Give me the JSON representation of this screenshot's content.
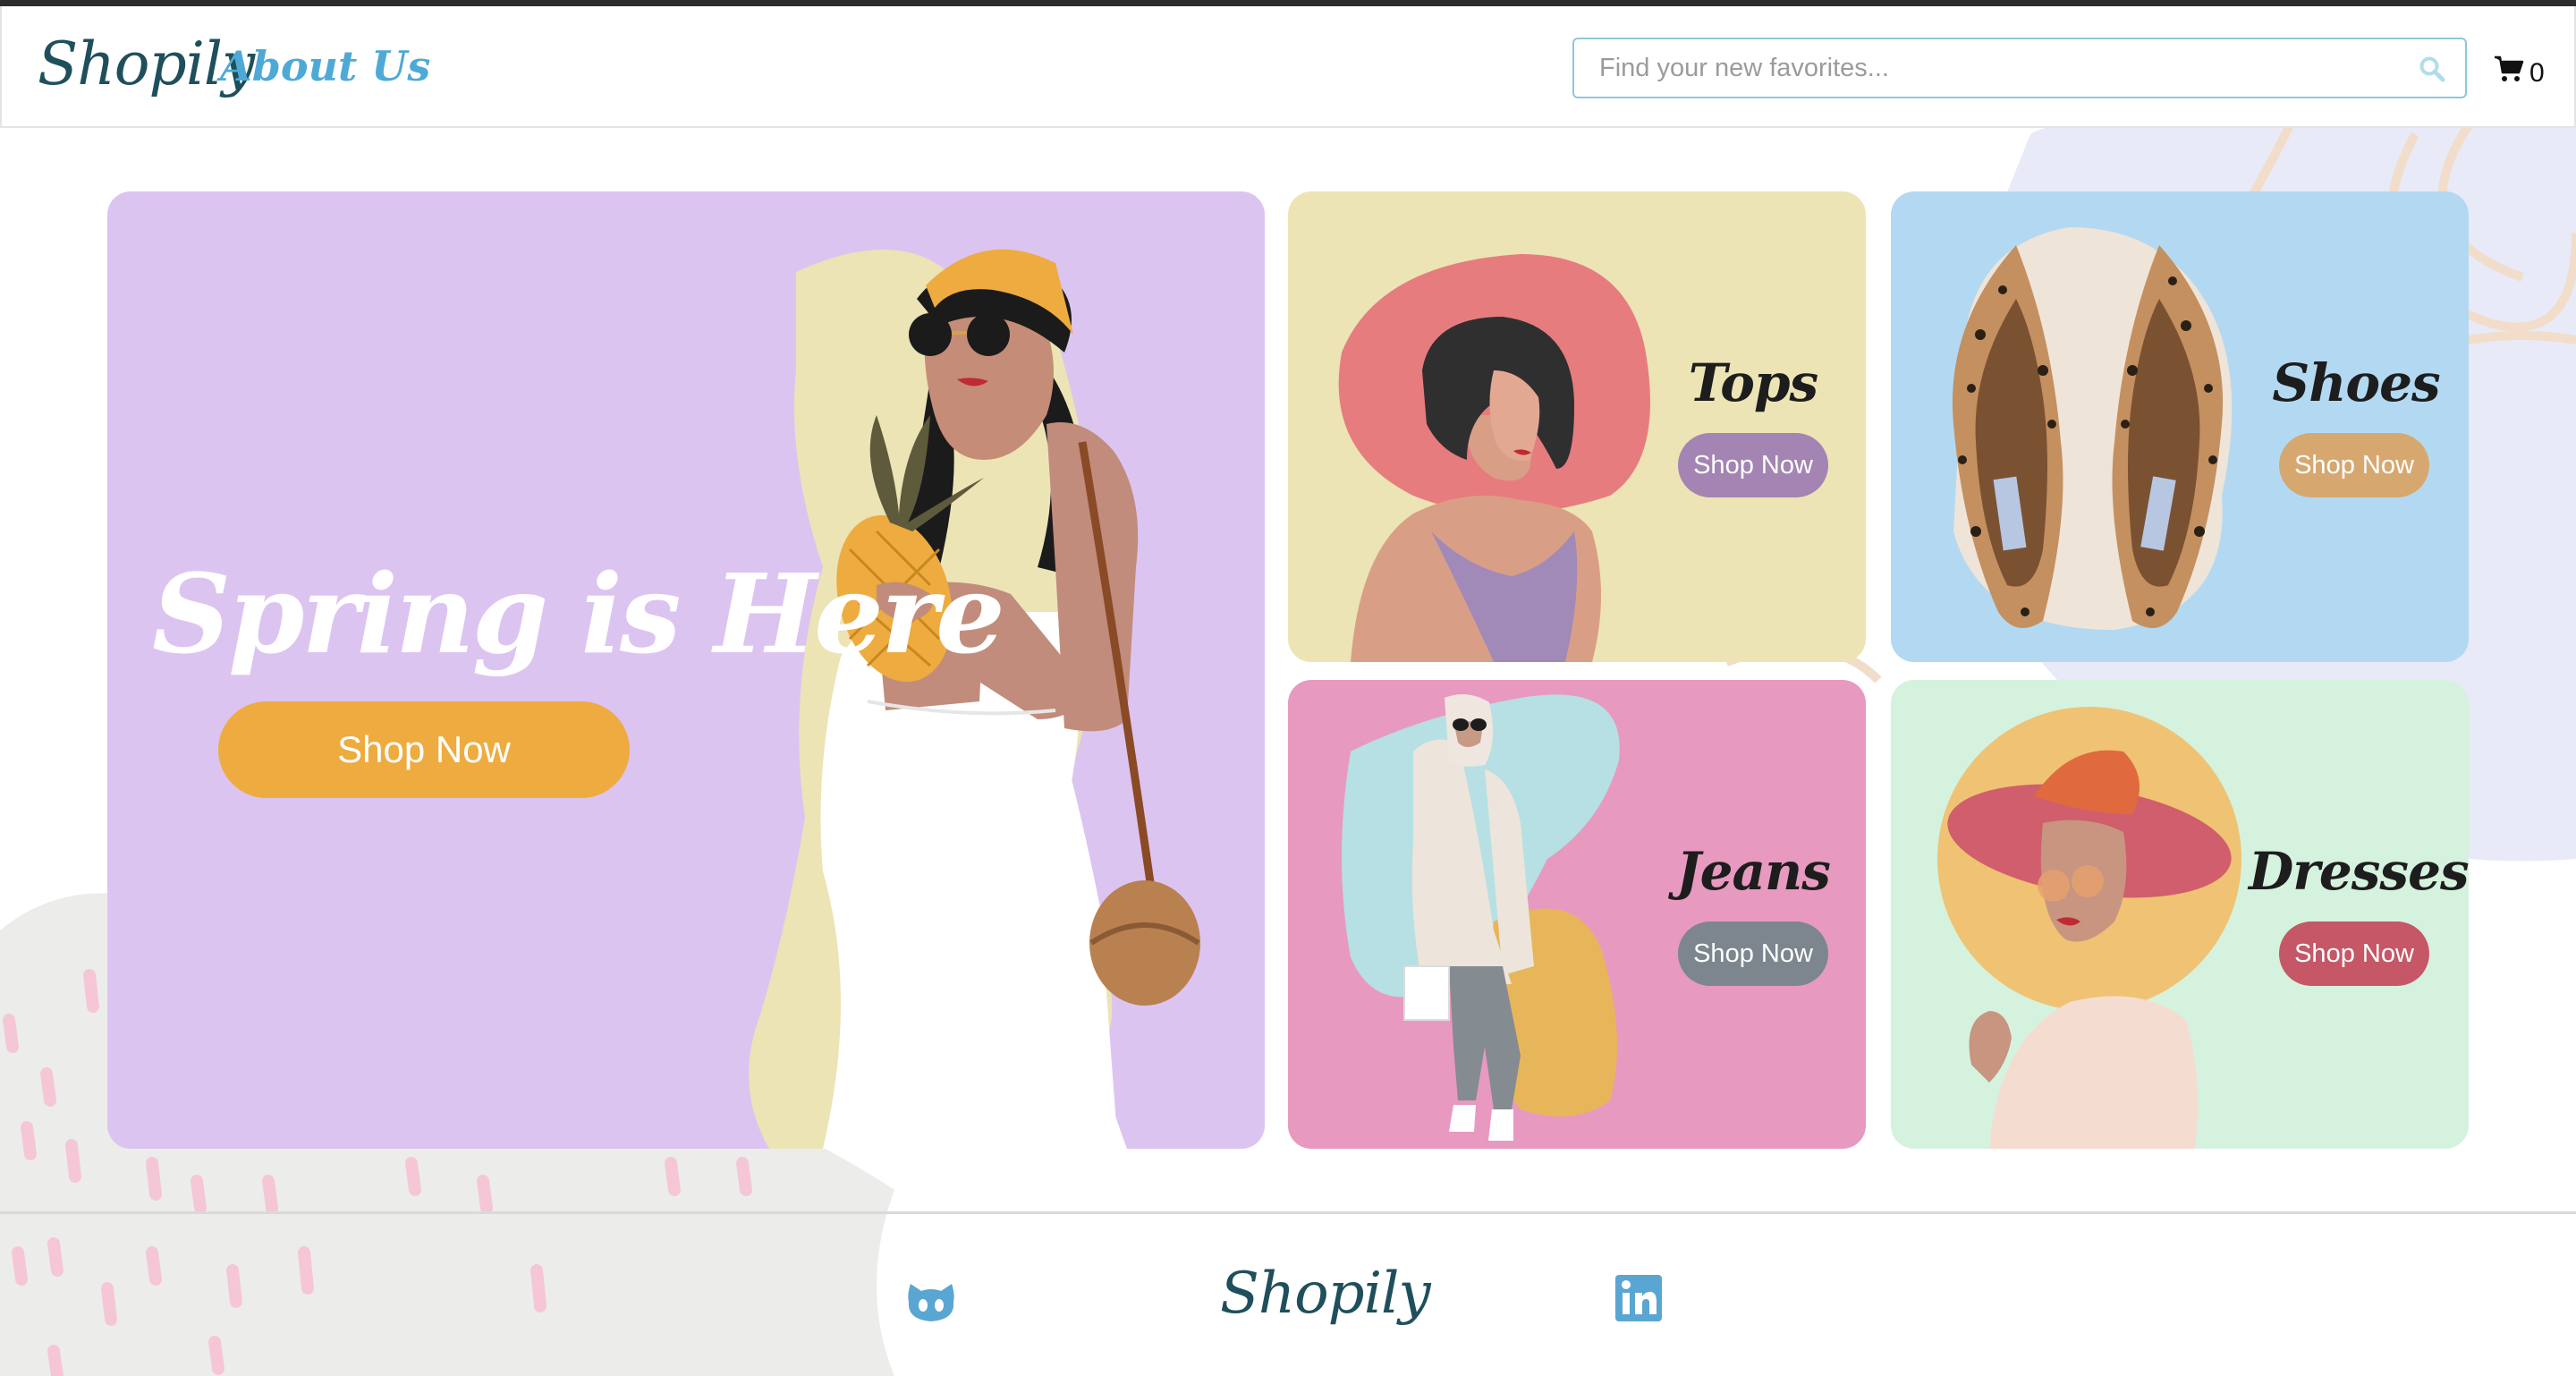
{
  "header": {
    "logo": "Shopily",
    "about_link": "About Us",
    "search_placeholder": "Find your new favorites...",
    "cart_count": "0",
    "icons": [
      "search-icon",
      "cart-icon"
    ]
  },
  "hero": {
    "title": "Spring is Here",
    "button_label": "Shop Now",
    "button_color": "#eeab3f",
    "background": "#dcc4f1"
  },
  "categories": [
    {
      "title": "Tops",
      "button_label": "Shop Now",
      "button_color": "#a384b3",
      "background": "#ece4b4"
    },
    {
      "title": "Shoes",
      "button_label": "Shop Now",
      "button_color": "#d6a870",
      "background": "#b3d9f2"
    },
    {
      "title": "Jeans",
      "button_label": "Shop Now",
      "button_color": "#7d868e",
      "background": "#e899bf"
    },
    {
      "title": "Dresses",
      "button_label": "Shop Now",
      "button_color": "#c55766",
      "background": "#d5f2df"
    }
  ],
  "footer": {
    "logo": "Shopily",
    "icons": [
      "github-icon",
      "linkedin-icon"
    ]
  }
}
